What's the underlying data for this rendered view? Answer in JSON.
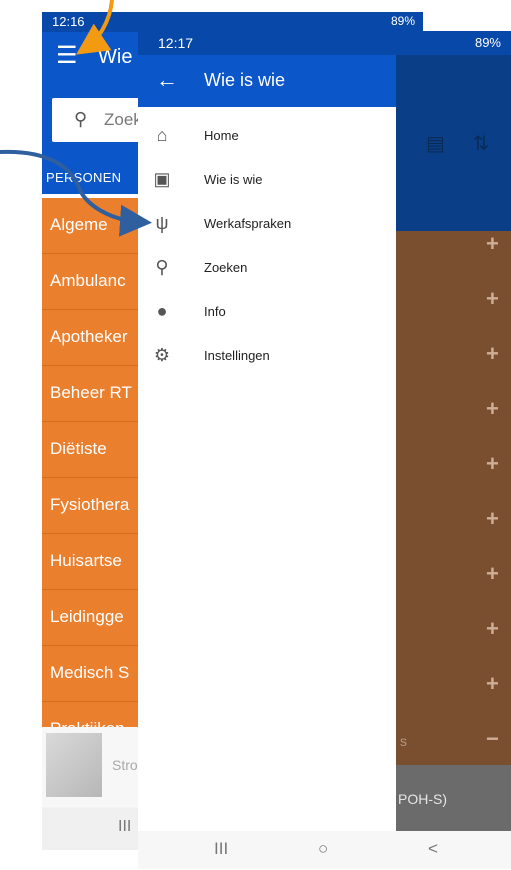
{
  "back_screen": {
    "time": "12:16",
    "status_right": "89%",
    "title": "Wie",
    "search_placeholder": "Zoek",
    "tab_label": "PERSONEN",
    "rows": [
      "Algeme",
      "Ambulanc",
      "Apotheker",
      "Beheer RT",
      "Diëtiste",
      "Fysiothera",
      "Huisartse",
      "Leidingge",
      "Medisch S",
      "Praktijkon"
    ],
    "photo_name": "Stro",
    "nav_recent": "III"
  },
  "front_screen": {
    "time": "12:17",
    "status_right": "89%",
    "drawer_title": "Wie is wie",
    "menu": [
      {
        "icon": "home-icon",
        "label": "Home"
      },
      {
        "icon": "contact-card-icon",
        "label": "Wie is wie"
      },
      {
        "icon": "stethoscope-icon",
        "label": "Werkafspraken"
      },
      {
        "icon": "search-icon",
        "label": "Zoeken"
      },
      {
        "icon": "chat-bubble-icon",
        "label": "Info"
      },
      {
        "icon": "gear-icon",
        "label": "Instellingen"
      }
    ],
    "behind_text": "s",
    "behind_row": "POH-S)",
    "nav": [
      "III",
      "○",
      "<"
    ]
  },
  "colors": {
    "app_blue": "#0b56c8",
    "orange": "#ea7f2e",
    "arrow_orange": "#f29a12",
    "arrow_blue": "#2f5f9e"
  }
}
